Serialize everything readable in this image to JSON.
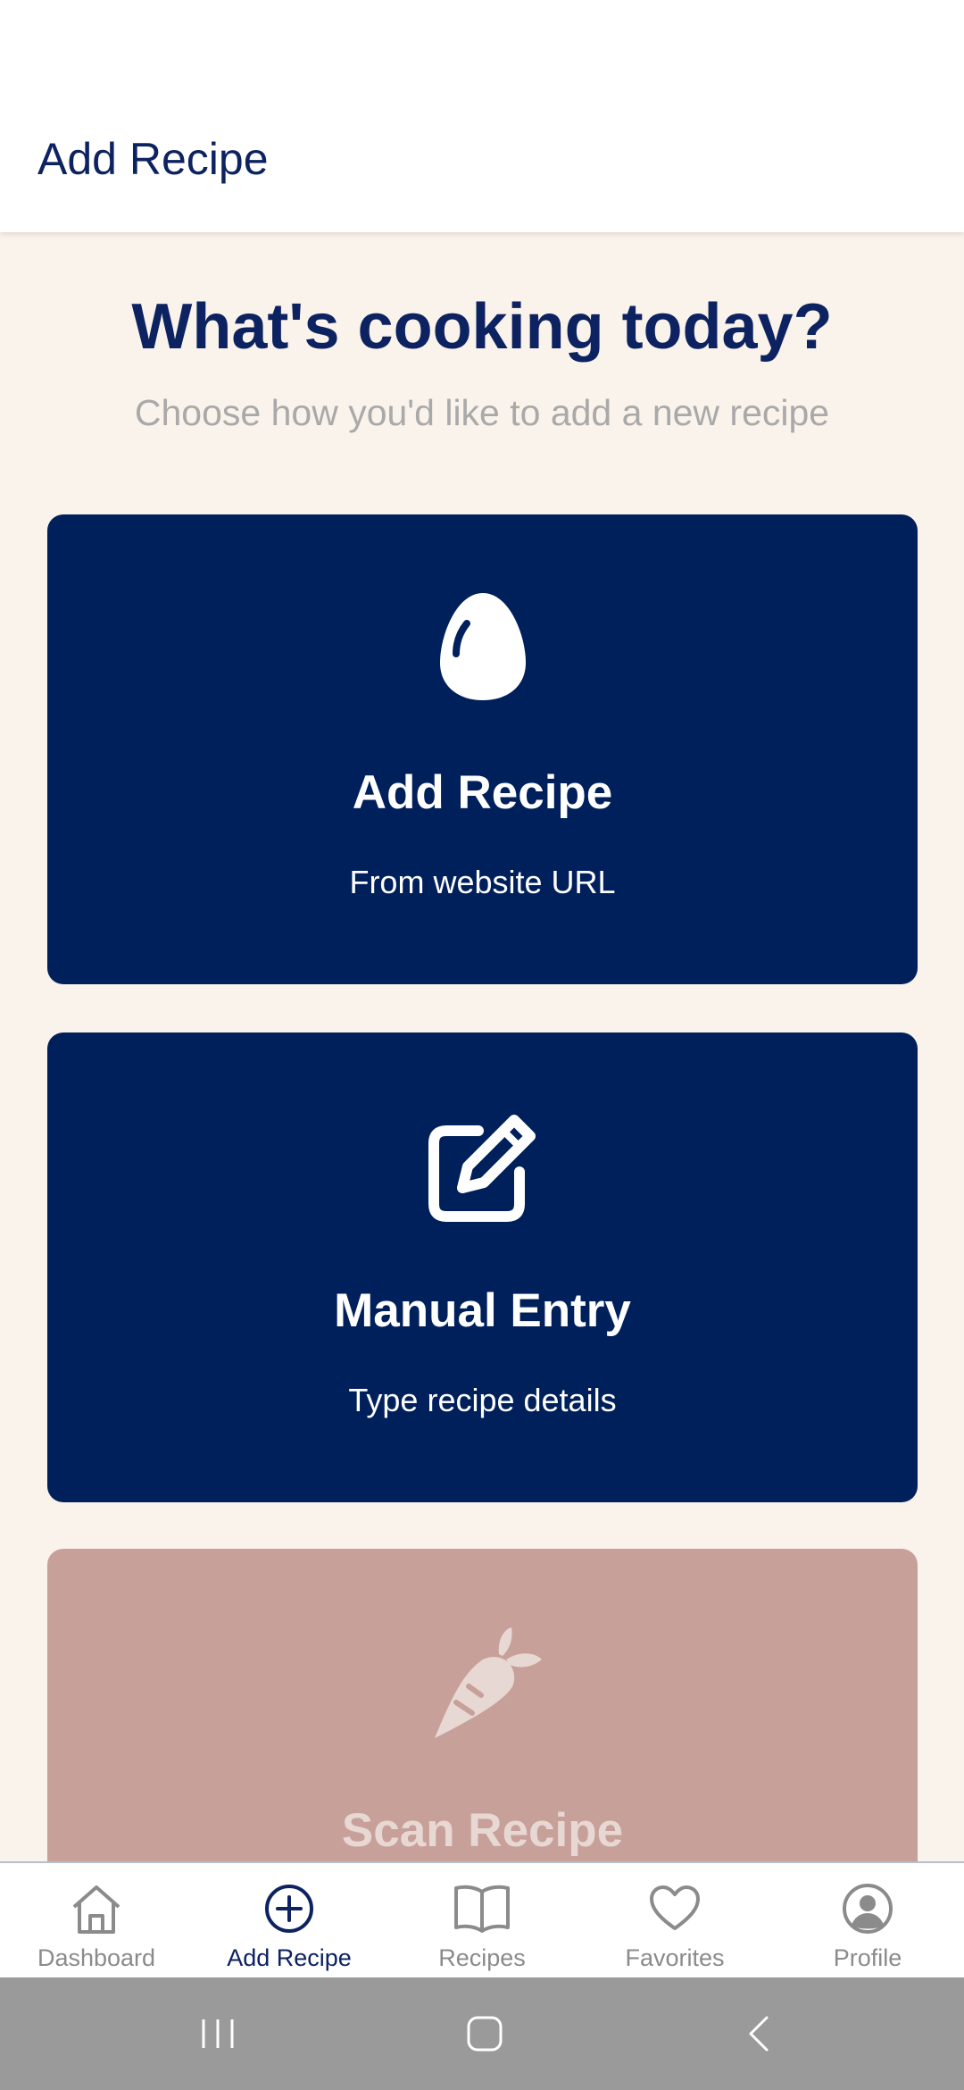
{
  "app_bar": {
    "title": "Add Recipe"
  },
  "hero": {
    "heading": "What's cooking today?",
    "subheading": "Choose how you'd like to add a new recipe"
  },
  "options": [
    {
      "title": "Add Recipe",
      "description": "From website URL",
      "icon": "egg-icon"
    },
    {
      "title": "Manual Entry",
      "description": "Type recipe details",
      "icon": "edit-icon"
    },
    {
      "title": "Scan Recipe",
      "icon": "carrot-icon"
    }
  ],
  "nav": {
    "items": [
      {
        "label": "Dashboard",
        "icon": "home-icon"
      },
      {
        "label": "Add Recipe",
        "icon": "plus-circle-icon",
        "active": true
      },
      {
        "label": "Recipes",
        "icon": "book-icon"
      },
      {
        "label": "Favorites",
        "icon": "heart-icon"
      },
      {
        "label": "Profile",
        "icon": "user-circle-icon"
      }
    ]
  },
  "colors": {
    "primary": "#00205B",
    "background": "#FAF3EB",
    "disabled_card": "#C8A09A",
    "muted_text": "#A9A9A9"
  }
}
